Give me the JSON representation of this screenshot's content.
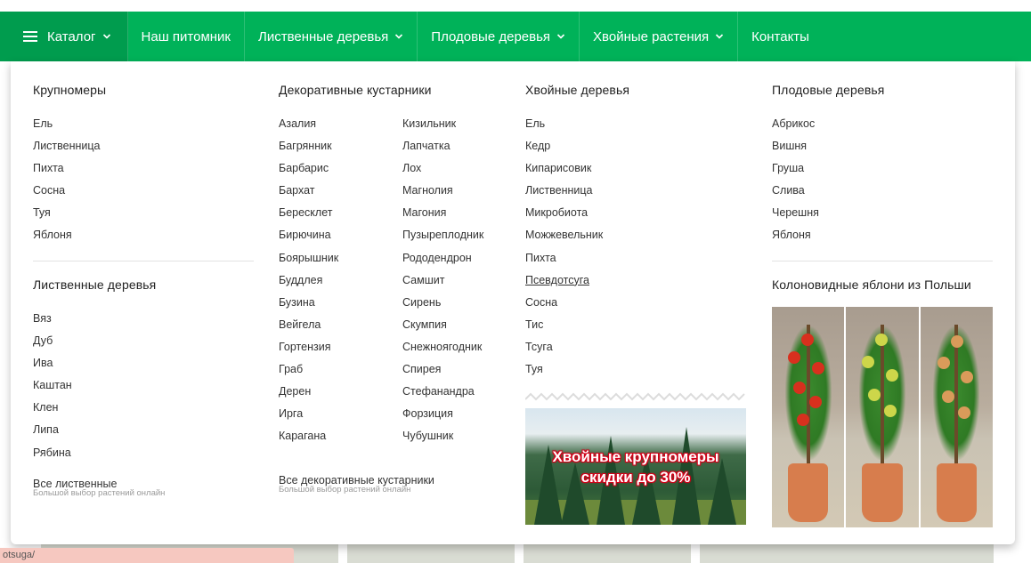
{
  "nav": {
    "items": [
      {
        "label": "Каталог",
        "has_dropdown": true,
        "has_menu_icon": true,
        "active": true
      },
      {
        "label": "Наш питомник",
        "has_dropdown": false
      },
      {
        "label": "Лиственные деревья",
        "has_dropdown": true
      },
      {
        "label": "Плодовые деревья",
        "has_dropdown": true
      },
      {
        "label": "Хвойные растения",
        "has_dropdown": true
      },
      {
        "label": "Контакты",
        "has_dropdown": false
      }
    ]
  },
  "menu": {
    "col1": {
      "heading1": "Крупномеры",
      "items1": [
        "Ель",
        "Лиственница",
        "Пихта",
        "Сосна",
        "Туя",
        "Яблоня"
      ],
      "heading2": "Лиственные деревья",
      "items2": [
        "Вяз",
        "Дуб",
        "Ива",
        "Каштан",
        "Клен",
        "Липа",
        "Рябина"
      ],
      "all_link": "Все лиственные",
      "all_sub": "Большой выбор растений онлайн"
    },
    "col2": {
      "heading": "Декоративные кустарники",
      "items_a": [
        "Азалия",
        "Багрянник",
        "Барбарис",
        "Бархат",
        "Бересклет",
        "Бирючина",
        "Боярышник",
        "Буддлея",
        "Бузина",
        "Вейгела",
        "Гортензия",
        "Граб",
        "Дерен",
        "Ирга",
        "Карагана"
      ],
      "items_b": [
        "Кизильник",
        "Лапчатка",
        "Лох",
        "Магнолия",
        "Магония",
        "Пузыреплодник",
        "Рододендрон",
        "Самшит",
        "Сирень",
        "Скумпия",
        "Снежноягодник",
        "Спирея",
        "Стефанандра",
        "Форзиция",
        "Чубушник"
      ],
      "all_link": "Все декоративные кустарники",
      "all_sub": "Большой выбор растений онлайн"
    },
    "col3": {
      "heading": "Хвойные деревья",
      "items": [
        "Ель",
        "Кедр",
        "Кипарисовик",
        "Лиственница",
        "Микробиота",
        "Можжевельник",
        "Пихта",
        "Псевдотсуга",
        "Сосна",
        "Тис",
        "Тсуга",
        "Туя"
      ],
      "hovered_index": 7,
      "promo_line1": "Хвойные крупномеры",
      "promo_line2": "скидки до 30%"
    },
    "col4": {
      "heading1": "Плодовые деревья",
      "items1": [
        "Абрикос",
        "Вишня",
        "Груша",
        "Слива",
        "Черешня",
        "Яблоня"
      ],
      "heading2": "Колоновидные яблони из Польши"
    }
  },
  "status_url": "otsuga/",
  "colors": {
    "nav_bg": "#00b259",
    "nav_active": "#009c4e",
    "promo_text": "#ffffff",
    "promo_outline": "#d2001a"
  }
}
